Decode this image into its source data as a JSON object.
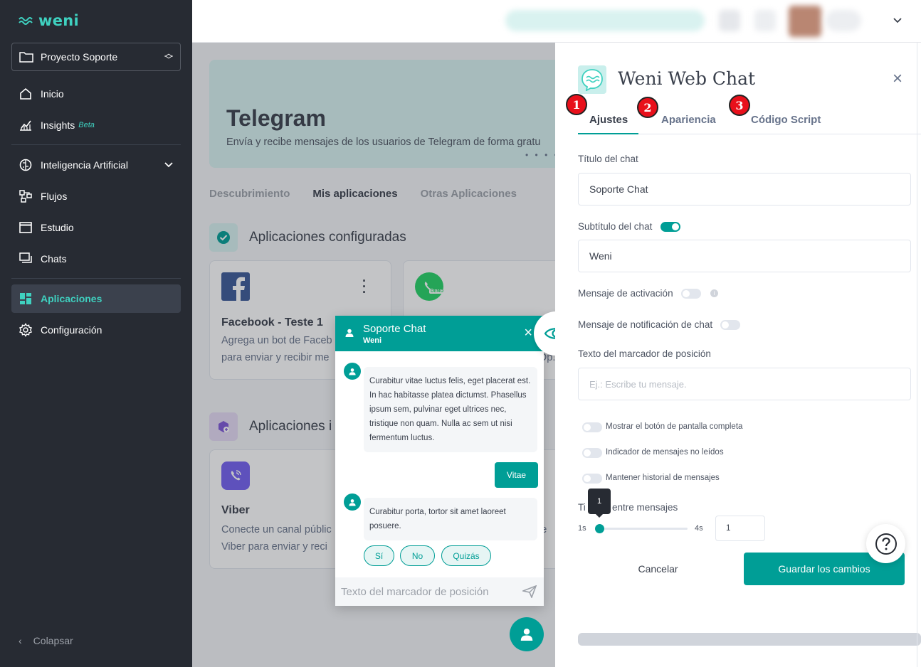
{
  "sidebar": {
    "logo": "weni",
    "project": "Proyecto Soporte",
    "items": [
      {
        "label": "Inicio",
        "icon": "home-icon"
      },
      {
        "label": "Insights",
        "badge": "Beta",
        "icon": "chart-icon"
      },
      {
        "label": "Inteligencia Artificial",
        "icon": "brain-icon"
      },
      {
        "label": "Flujos",
        "icon": "flow-icon"
      },
      {
        "label": "Estudio",
        "icon": "window-icon"
      },
      {
        "label": "Chats",
        "icon": "chats-icon"
      },
      {
        "label": "Aplicaciones",
        "icon": "apps-icon",
        "active": true
      },
      {
        "label": "Configuración",
        "icon": "gear-icon"
      }
    ],
    "collapse": "Colapsar"
  },
  "main": {
    "hero": {
      "title": "Telegram",
      "subtitle": "Envía y recibe mensajes de los usuarios de Telegram de forma gratu",
      "dots": "• • • •"
    },
    "tabs": [
      "Descubrimiento",
      "Mis aplicaciones",
      "Otras Aplicaciones"
    ],
    "configured_title": "Aplicaciones configuradas",
    "installed_title": "Aplicaciones i",
    "cards": [
      {
        "name": "Facebook - Teste 1",
        "desc1": "Agrega un bot de Faceb",
        "desc2": "para enviar y recibir me"
      },
      {
        "whatsapp_badge": "DEMO",
        "fragment": "Op."
      },
      {
        "name": "Viber",
        "desc1": "Conecte un canal públic",
        "desc2": "Viber para enviar y reci",
        "fragment": "le"
      }
    ]
  },
  "chat": {
    "title": "Soporte Chat",
    "subtitle": "Weni",
    "messages": [
      "Curabitur vitae luctus felis, eget placerat est. In hac habitasse platea dictumst. Phasellus ipsum sem, pulvinar eget ultrices nec, tristique non quam. Nulla ac sem ut nisi fermentum luctus.",
      "Curabitur porta, tortor sit amet laoreet posuere."
    ],
    "user_reply": "Vitae",
    "quick_replies": [
      "Sí",
      "No",
      "Quizás"
    ],
    "input_placeholder": "Texto del marcador de posición"
  },
  "panel": {
    "title": "Weni Web Chat",
    "tabs": [
      "Ajustes",
      "Apariencia",
      "Código Script"
    ],
    "badges": [
      "1",
      "2",
      "3"
    ],
    "chat_title_label": "Título del chat",
    "chat_title_value": "Soporte Chat",
    "chat_subtitle_label": "Subtítulo del chat",
    "chat_subtitle_value": "Weni",
    "activation_label": "Mensaje de activación",
    "notification_label": "Mensaje de notificación de chat",
    "placeholder_label": "Texto del marcador de posición",
    "placeholder_input": "Ej.: Escribe tu mensaje.",
    "options": [
      {
        "label": "Mostrar el botón de pantalla completa",
        "on": false
      },
      {
        "label": "Indicador de mensajes no leídos",
        "on": false
      },
      {
        "label": "Mantener historial de mensajes",
        "on": false
      }
    ],
    "time_label_a": "Ti",
    "time_label_b": "entre mensajes",
    "slider": {
      "min": "1s",
      "max": "4s",
      "value": "1",
      "fraction": 0
    },
    "time_input": "1",
    "cancel": "Cancelar",
    "save": "Guardar los cambios",
    "help": "?"
  },
  "colors": {
    "accent": "#009e96",
    "sidebar": "#272b33",
    "brand_text": "#3fd1c0",
    "badge": "#e8101b"
  }
}
